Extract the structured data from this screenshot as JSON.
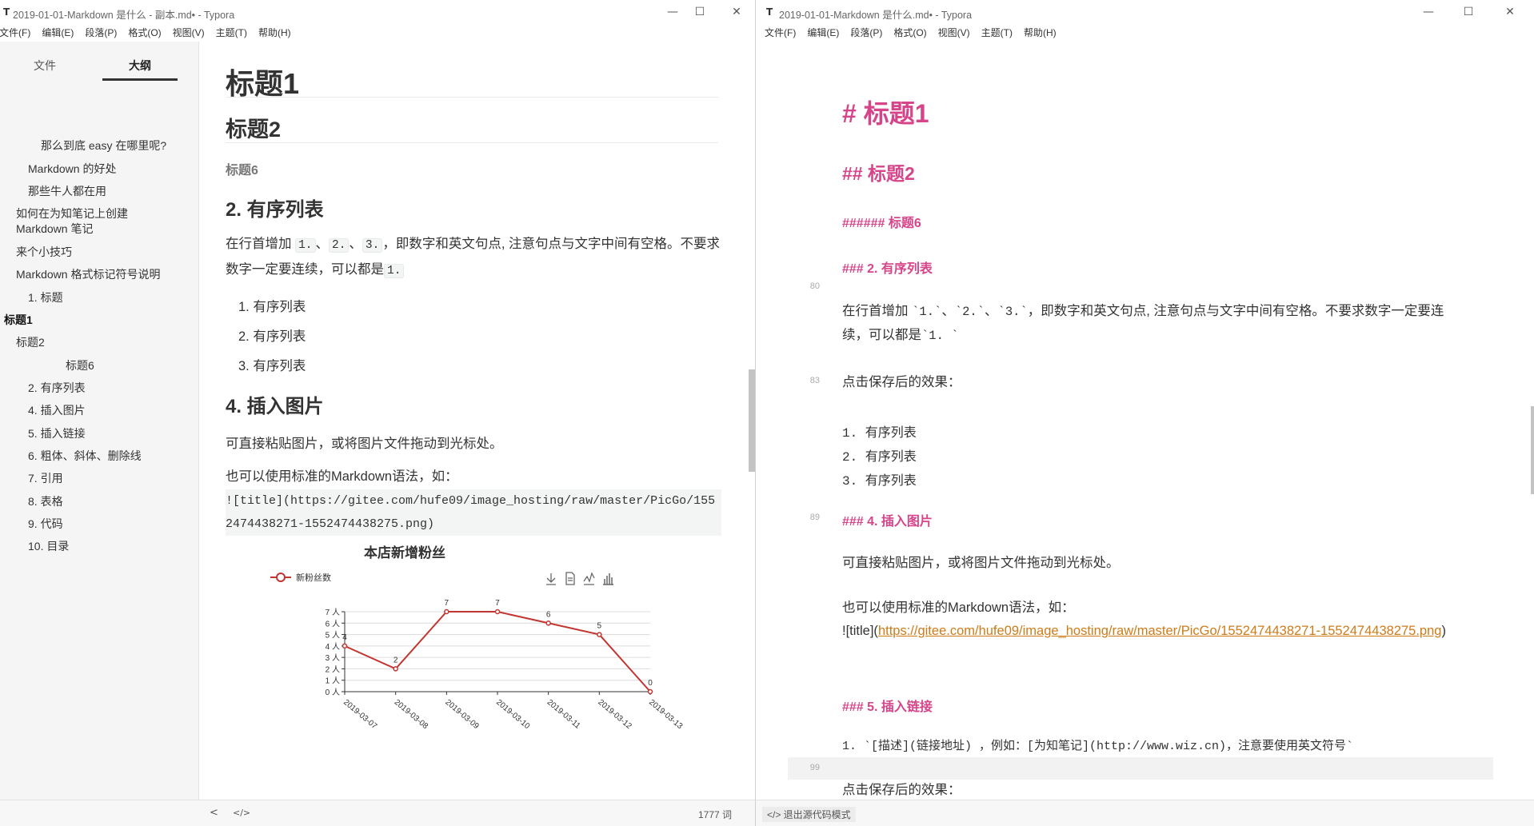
{
  "left_window": {
    "icon": "T",
    "title": "2019-01-01-Markdown 是什么 - 副本.md• - Typora",
    "controls": {
      "minimize": "—",
      "maximize": "☐",
      "close": "✕"
    },
    "menu": [
      "文件(F)",
      "编辑(E)",
      "段落(P)",
      "格式(O)",
      "视图(V)",
      "主题(T)",
      "帮助(H)"
    ],
    "sidebar": {
      "tab_files": "文件",
      "tab_outline": "大纲",
      "outline": [
        "那么到底 easy 在哪里呢?",
        "Markdown 的好处",
        "那些牛人都在用",
        "如何在为知笔记上创建",
        "Markdown 笔记",
        "来个小技巧",
        "Markdown 格式标记符号说明",
        "1. 标题",
        "标题1",
        "标题2",
        "标题6",
        "2. 有序列表",
        "4. 插入图片",
        "5. 插入链接",
        "6. 粗体、斜体、删除线",
        "7. 引用",
        "8. 表格",
        "9. 代码",
        "10. 目录"
      ]
    },
    "editor": {
      "h1": "标题1",
      "h2": "标题2",
      "h6": "标题6",
      "h3_ordered": "2. 有序列表",
      "para_ordered_a": "在行首增加 ",
      "code_1": "1.",
      "sep1": "、",
      "code_2": "2.",
      "sep2": "、",
      "code_3": "3.",
      "para_ordered_b": "，即数字和英文句点, 注意句点与文字中间有空格。不要求数字一定要连续，可以都是",
      "code_4": "1.",
      "list": [
        "1. 有序列表",
        "2. 有序列表",
        "3. 有序列表"
      ],
      "h3_image": "4. 插入图片",
      "para_image_1": "可直接粘贴图片，或将图片文件拖动到光标处。",
      "para_image_2": "也可以使用标准的Markdown语法，如：",
      "image_syntax": "![title](https://gitee.com/hufe09/image_hosting/raw/master/PicGo/1552474438271-1552474438275.png)"
    },
    "status": {
      "back_icon": "<",
      "source_icon": "</>",
      "word_count": "1777 词"
    }
  },
  "right_window": {
    "icon": "T",
    "title": "2019-01-01-Markdown 是什么.md• - Typora",
    "controls": {
      "minimize": "—",
      "maximize": "☐",
      "close": "✕"
    },
    "menu": [
      "文件(F)",
      "编辑(E)",
      "段落(P)",
      "格式(O)",
      "视图(V)",
      "主题(T)",
      "帮助(H)"
    ],
    "source": {
      "h1": "# 标题1",
      "h2": "## 标题2",
      "h6": "###### 标题6",
      "h3_ordered": "### 2. 有序列表",
      "line_80": "80",
      "para_a": "在行首增加 ",
      "code_1": "`1.`",
      "sep1": "、",
      "code_2": "`2.`",
      "sep2": "、",
      "code_3": "`3.`",
      "para_b": "，即数字和英文句点, 注意句点与文字中间有空格。不要求数字一定要连续，可以都是",
      "code_4": "`1. `",
      "line_83": "83",
      "after_save": "点击保存后的效果：",
      "list": [
        "1. 有序列表",
        "2. 有序列表",
        "3. 有序列表"
      ],
      "line_89": "89",
      "h3_image": "### 4. 插入图片",
      "para_image_1": "可直接粘贴图片，或将图片文件拖动到光标处。",
      "para_image_2": "也可以使用标准的Markdown语法，如：",
      "image_prefix": "![title](",
      "image_url": "https://gitee.com/hufe09/image_hosting/raw/master/PicGo/1552474438271-1552474438275.png",
      "image_suffix": ")",
      "h3_link": "### 5. 插入链接",
      "link_line": "1. `[描述](链接地址) ，例如：[为知笔记](http://www.wiz.cn)，注意要使用英文符号`",
      "line_99": "99",
      "after_save_2": "点击保存后的效果："
    },
    "status": {
      "exit_source": "</> 退出源代码模式"
    }
  },
  "chart_data": {
    "type": "line",
    "title": "本店新增粉丝",
    "series": [
      {
        "name": "新粉丝数",
        "values": [
          4,
          2,
          7,
          7,
          6,
          5,
          0
        ]
      }
    ],
    "categories": [
      "2019-03-07",
      "2019-03-08",
      "2019-03-09",
      "2019-03-10",
      "2019-03-11",
      "2019-03-12",
      "2019-03-13"
    ],
    "ylim": [
      0,
      7
    ],
    "y_ticks": [
      "0 人",
      "1 人",
      "2 人",
      "3 人",
      "4 人",
      "5 人",
      "6 人",
      "7 人"
    ],
    "grid": true,
    "legend": "top-left",
    "line_color": "#c23531",
    "toolbox_icons": [
      "download-icon",
      "data-view-icon",
      "line-chart-icon",
      "bar-chart-icon"
    ]
  }
}
